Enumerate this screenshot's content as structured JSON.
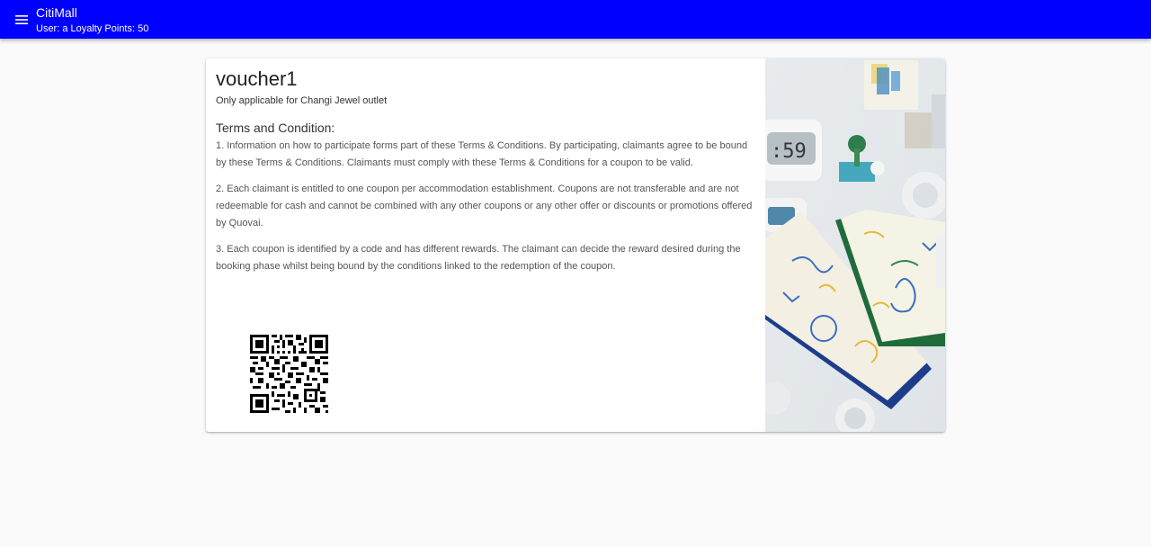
{
  "appbar": {
    "title": "CitiMall",
    "subtitle": "User: a Loyalty Points: 50",
    "color": "#0000ff"
  },
  "voucher": {
    "title": "voucher1",
    "subtitle": "Only applicable for Changi Jewel outlet",
    "terms_heading": "Terms and Condition:",
    "terms": [
      "1. Information on how to participate forms part of these Terms & Conditions. By participating, claimants agree to be bound by these Terms & Conditions. Claimants must comply with these Terms & Conditions for a coupon to be valid.",
      "2. Each claimant is entitled to one coupon per accommodation establishment. Coupons are not transferable and are not redeemable for cash and cannot be combined with any other coupons or any other offer or discounts or promotions offered by Quovai.",
      "3. Each coupon is identified by a code and has different rewards. The claimant can decide the reward desired during the booking phase whilst being bound by the conditions linked to the redemption of the coupon."
    ]
  },
  "icons": {
    "menu": "menu-icon",
    "qr": "qr-code"
  }
}
